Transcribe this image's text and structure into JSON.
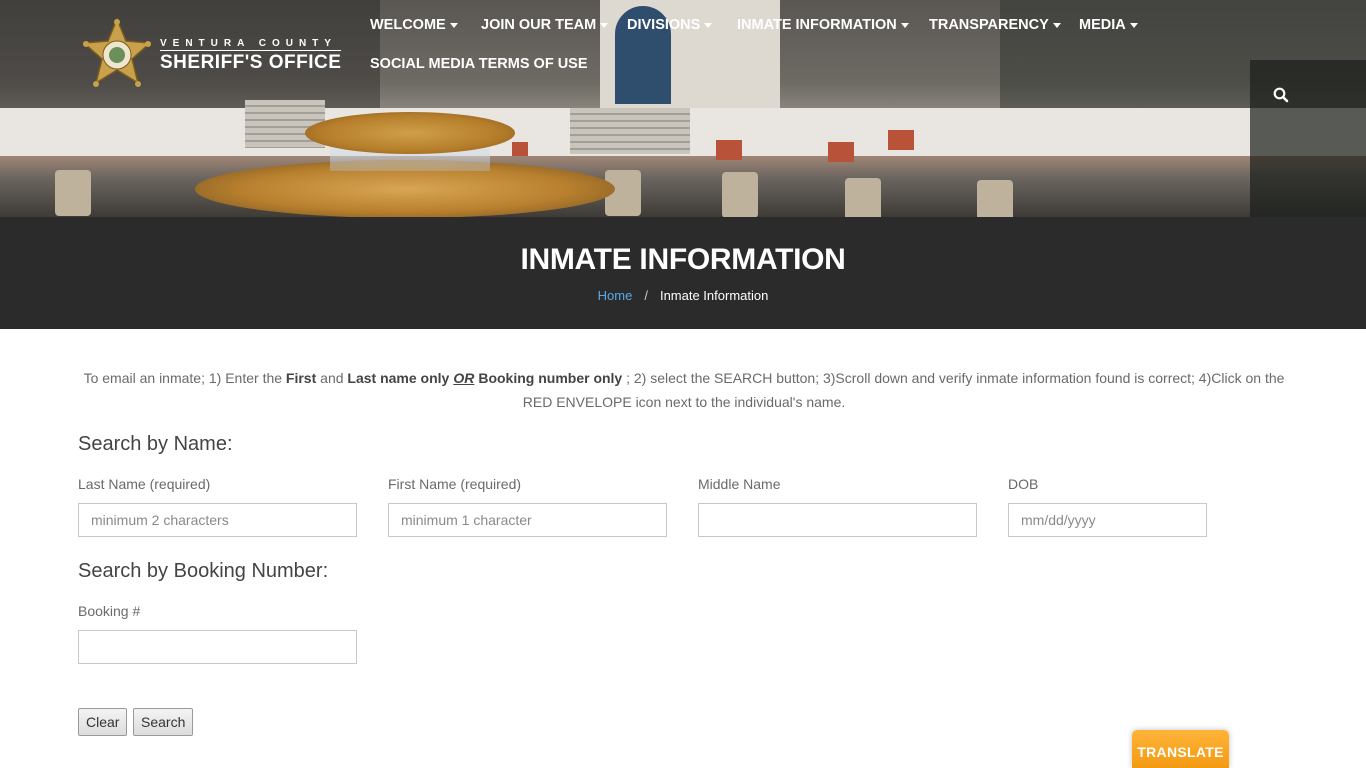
{
  "header": {
    "brand_top": "VENTURA COUNTY",
    "brand_bottom": "SHERIFF'S OFFICE",
    "nav": [
      {
        "label": "WELCOME",
        "has_dropdown": true
      },
      {
        "label": "JOIN OUR TEAM",
        "has_dropdown": true
      },
      {
        "label": "DIVISIONS",
        "has_dropdown": true
      },
      {
        "label": "INMATE INFORMATION",
        "has_dropdown": true
      },
      {
        "label": "TRANSPARENCY",
        "has_dropdown": true
      },
      {
        "label": "MEDIA",
        "has_dropdown": true
      },
      {
        "label": "SOCIAL MEDIA TERMS OF USE",
        "has_dropdown": false
      }
    ],
    "search_icon": "search-icon"
  },
  "page": {
    "title": "INMATE INFORMATION",
    "breadcrumb_home": "Home",
    "breadcrumb_sep": "/",
    "breadcrumb_current": "Inmate Information"
  },
  "intro": {
    "t1": "To email an inmate; 1) Enter the ",
    "b1": "First",
    "t2": " and ",
    "b2": "Last name only",
    "or": "OR",
    "b3": "Booking number only",
    "t3": " ; 2) select the SEARCH button;  3)Scroll down and verify inmate information found is correct; 4)Click on the RED ENVELOPE icon next to the individual's name."
  },
  "search_name": {
    "heading": "Search by Name:",
    "last_label": "Last Name (required)",
    "last_placeholder": "minimum 2 characters",
    "first_label": "First Name (required)",
    "first_placeholder": "minimum 1 character",
    "middle_label": "Middle Name",
    "middle_placeholder": "",
    "dob_label": "DOB",
    "dob_placeholder": "mm/dd/yyyy"
  },
  "search_booking": {
    "heading": "Search by Booking Number:",
    "booking_label": "Booking #",
    "booking_placeholder": ""
  },
  "buttons": {
    "clear": "Clear",
    "search": "Search"
  },
  "translate": "TRANSLATE",
  "colors": {
    "title_band": "#2b2b2b",
    "breadcrumb_link": "#5aa9e6",
    "translate_bg": "#f7a51f"
  }
}
